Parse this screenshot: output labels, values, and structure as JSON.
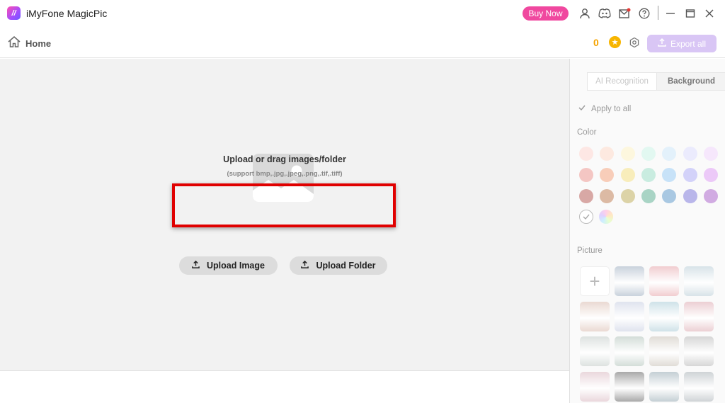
{
  "app": {
    "title": "iMyFone MagicPic",
    "logo_glyph": "//",
    "buy_now_label": "Buy Now",
    "accent_color": "#f0489f"
  },
  "toolbar": {
    "home_label": "Home",
    "credits": "0",
    "export_all_label": "Export all"
  },
  "upload": {
    "title": "Upload or drag images/folder",
    "subtitle": "(support bmp,.jpg,.jpeg,.png,.tif,.tiff)",
    "upload_image_label": "Upload Image",
    "upload_folder_label": "Upload Folder"
  },
  "panel": {
    "tabs": [
      {
        "label": "AI Recognition"
      },
      {
        "label": "Background"
      }
    ],
    "apply_all_label": "Apply to all",
    "color_label": "Color",
    "picture_label": "Picture",
    "colors": [
      "#fde7e4",
      "#fde9e0",
      "#fdf7de",
      "#e2f8f1",
      "#e3f1fb",
      "#ebebfd",
      "#f6e7fc",
      "#f4c6c3",
      "#f8cdb9",
      "#f8edbb",
      "#c9ece0",
      "#c7e2f8",
      "#d3d2f9",
      "#ecc9f8",
      "#d8a8a5",
      "#dcbaa4",
      "#dcd3a7",
      "#a9d4c5",
      "#a9c8e2",
      "#b9b6ea",
      "#d1abe2"
    ],
    "pictures": [
      "#c9d2dc",
      "#f1cdd0",
      "#d8e3e8",
      "#ead9d2",
      "#dfe3ee",
      "#cfe2e8",
      "#eccfd3",
      "#dde2e0",
      "#d3ddd8",
      "#e0dcd6",
      "#d6d6d6",
      "#ead7dc",
      "#a9a9a9",
      "#c4cfd4",
      "#cfd3d6"
    ]
  }
}
